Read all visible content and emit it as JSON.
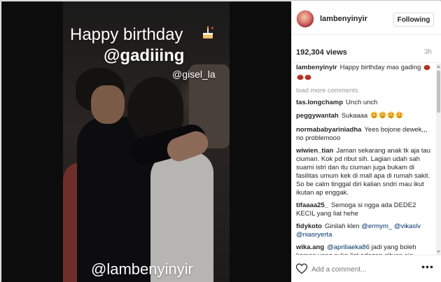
{
  "story": {
    "caption_line1": "Happy birthday",
    "caption_line2": "@gadiiing",
    "tag": "@gisel_la",
    "watermark": "@lambenyinyir",
    "caption_icon": "cake-icon"
  },
  "header": {
    "username": "lambenyinyir",
    "follow_label": "Following"
  },
  "stats": {
    "views": "192,304 views",
    "time": "3h"
  },
  "comments": {
    "caption": {
      "user": "lambenyinyir",
      "text": "Happy birthday mas gading"
    },
    "load_more": "load more comments",
    "items": [
      {
        "user": "tas.longchamp",
        "text": "Unch unch"
      },
      {
        "user": "peggywantah",
        "text": "Sukaaaa"
      },
      {
        "user": "normababyariniadha",
        "text": "Yees bojone dewek,,, no problemooo"
      },
      {
        "user": "wiwien_tian",
        "text": "Jaman sekarang anak tk aja tau ciuman. Kok pd ribut sih. Lagian udah sah suami istri dan itu ciuman juga bukam di fasilitas umum kek di mall apa di rumah sakit. So be calm tinggal diri kalian sndri mau ikut ikutan ap enggak."
      },
      {
        "user": "tifaaaa25_",
        "text": "Semoga si ngga ada DEDE2 KECIL yang liat hehe"
      },
      {
        "user": "fidykoto",
        "text": "Ginilah klen",
        "mention1": "@ermym_",
        "mention2": "@vikaslv",
        "mention3": "@niasryerta"
      },
      {
        "user": "wika.ang",
        "mention": "@apriliaeka86",
        "text": "jadi yang boleh komen yang suka liat adegan gituan aja"
      }
    ]
  },
  "footer": {
    "placeholder": "Add a comment...",
    "more_label": "•••"
  },
  "colors": {
    "border": "#efefef",
    "text": "#262626",
    "muted": "#999999",
    "mention": "#003569",
    "lips": "#c0392b"
  },
  "icons": [
    "cake-icon",
    "lips-icon",
    "heart-eyes-icon",
    "heart-icon",
    "more-icon"
  ]
}
